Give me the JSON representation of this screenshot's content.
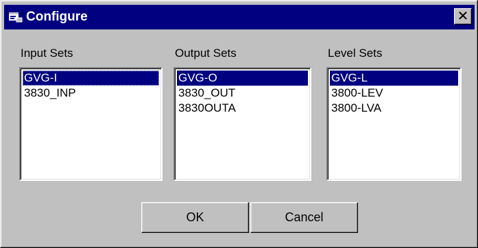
{
  "window": {
    "title": "Configure",
    "close_glyph": "✕",
    "title_icon": "folder-app-icon"
  },
  "input_sets": {
    "label": "Input Sets",
    "items": [
      "GVG-I",
      "3830_INP"
    ],
    "selected": "GVG-I"
  },
  "output_sets": {
    "label": "Output Sets",
    "items": [
      "GVG-O",
      "3830_OUT",
      "3830OUTA"
    ],
    "selected": "GVG-O"
  },
  "level_sets": {
    "label": "Level Sets",
    "items": [
      "GVG-L",
      "3800-LEV",
      "3800-LVA"
    ],
    "selected": "GVG-L"
  },
  "buttons": {
    "ok_label": "OK",
    "cancel_label": "Cancel"
  },
  "colors": {
    "titlebar": "#000080",
    "selection": "#000080",
    "face": "#c0c0c0"
  }
}
